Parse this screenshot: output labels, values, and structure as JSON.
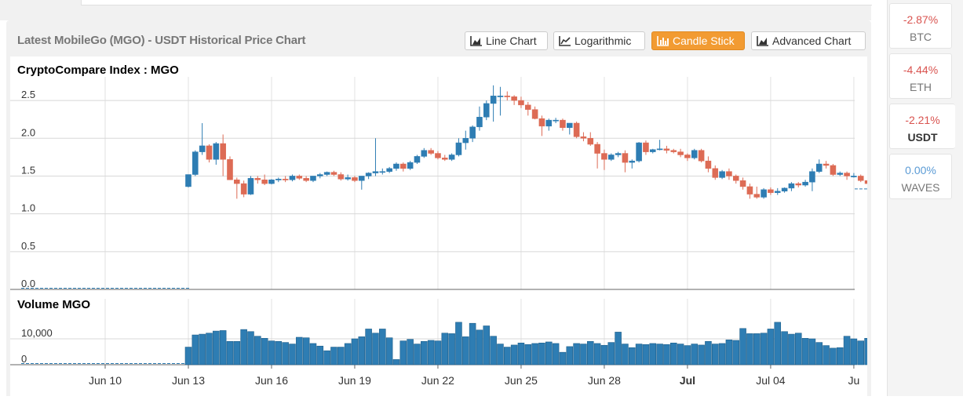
{
  "header": {
    "title": "Latest MobileGo (MGO) - USDT Historical Price Chart",
    "buttons": [
      {
        "label": "Line Chart",
        "icon": "area-chart-icon",
        "active": false
      },
      {
        "label": "Logarithmic",
        "icon": "line-chart-icon",
        "active": false
      },
      {
        "label": "Candle Stick",
        "icon": "bar-chart-icon",
        "active": true
      },
      {
        "label": "Advanced Chart",
        "icon": "area-chart-icon",
        "active": false
      }
    ]
  },
  "sidebar": {
    "pairs": [
      {
        "change": "-2.87%",
        "symbol": "BTC",
        "color": "#d9534f"
      },
      {
        "change": "-4.44%",
        "symbol": "ETH",
        "color": "#d9534f"
      },
      {
        "change": "-2.21%",
        "symbol": "USDT",
        "color": "#d9534f",
        "active": true
      },
      {
        "change": "0.00%",
        "symbol": "WAVES",
        "color": "#5b9bd5"
      }
    ]
  },
  "colors": {
    "up": "#2e7db3",
    "down": "#dd6b55",
    "accent": "#f29b32"
  },
  "chart_data": [
    {
      "type": "candlestick",
      "title": "CryptoCompare Index : MGO",
      "ylim": [
        0,
        2.75
      ],
      "yticks": [
        "0.0",
        "0.5",
        "1.0",
        "1.5",
        "2.0",
        "2.5"
      ],
      "xticks": [
        "Jun 10",
        "Jun 13",
        "Jun 16",
        "Jun 19",
        "Jun 22",
        "Jun 25",
        "Jun 28",
        "Jul",
        "Jul 04",
        "Ju"
      ],
      "bold_xtick": "Jul",
      "candles_per_day": 4,
      "first_candle_date": "Jun 13",
      "last_price": 1.33,
      "ohlc": [
        [
          1.36,
          1.52,
          1.35,
          1.52
        ],
        [
          1.52,
          1.84,
          1.5,
          1.82
        ],
        [
          1.82,
          2.2,
          1.78,
          1.9
        ],
        [
          1.9,
          1.92,
          1.68,
          1.72
        ],
        [
          1.72,
          1.95,
          1.65,
          1.93
        ],
        [
          1.93,
          2.05,
          1.5,
          1.72
        ],
        [
          1.72,
          1.76,
          1.45,
          1.45
        ],
        [
          1.45,
          1.48,
          1.2,
          1.4
        ],
        [
          1.4,
          1.44,
          1.22,
          1.26
        ],
        [
          1.26,
          1.5,
          1.25,
          1.47
        ],
        [
          1.47,
          1.5,
          1.4,
          1.45
        ],
        [
          1.45,
          1.52,
          1.38,
          1.4
        ],
        [
          1.4,
          1.46,
          1.39,
          1.45
        ],
        [
          1.45,
          1.48,
          1.42,
          1.46
        ],
        [
          1.46,
          1.5,
          1.42,
          1.45
        ],
        [
          1.45,
          1.52,
          1.43,
          1.5
        ],
        [
          1.5,
          1.52,
          1.45,
          1.47
        ],
        [
          1.47,
          1.5,
          1.42,
          1.44
        ],
        [
          1.44,
          1.5,
          1.42,
          1.5
        ],
        [
          1.5,
          1.54,
          1.47,
          1.52
        ],
        [
          1.52,
          1.56,
          1.5,
          1.55
        ],
        [
          1.55,
          1.57,
          1.5,
          1.52
        ],
        [
          1.52,
          1.55,
          1.44,
          1.46
        ],
        [
          1.46,
          1.52,
          1.44,
          1.48
        ],
        [
          1.48,
          1.5,
          1.42,
          1.44
        ],
        [
          1.44,
          1.5,
          1.32,
          1.5
        ],
        [
          1.5,
          1.55,
          1.46,
          1.54
        ],
        [
          1.54,
          2.0,
          1.5,
          1.56
        ],
        [
          1.56,
          1.6,
          1.52,
          1.56
        ],
        [
          1.56,
          1.62,
          1.54,
          1.6
        ],
        [
          1.6,
          1.68,
          1.57,
          1.66
        ],
        [
          1.66,
          1.68,
          1.56,
          1.6
        ],
        [
          1.6,
          1.7,
          1.58,
          1.68
        ],
        [
          1.68,
          1.78,
          1.66,
          1.76
        ],
        [
          1.76,
          1.87,
          1.74,
          1.84
        ],
        [
          1.84,
          1.87,
          1.78,
          1.8
        ],
        [
          1.8,
          1.83,
          1.72,
          1.74
        ],
        [
          1.74,
          1.78,
          1.7,
          1.72
        ],
        [
          1.72,
          1.8,
          1.7,
          1.78
        ],
        [
          1.78,
          2.0,
          1.76,
          1.94
        ],
        [
          1.94,
          2.1,
          1.85,
          2.0
        ],
        [
          2.0,
          2.17,
          1.95,
          2.15
        ],
        [
          2.15,
          2.42,
          2.1,
          2.28
        ],
        [
          2.28,
          2.5,
          2.24,
          2.46
        ],
        [
          2.46,
          2.7,
          2.22,
          2.56
        ],
        [
          2.56,
          2.68,
          2.3,
          2.56
        ],
        [
          2.56,
          2.62,
          2.5,
          2.55
        ],
        [
          2.55,
          2.57,
          2.44,
          2.5
        ],
        [
          2.5,
          2.55,
          2.4,
          2.44
        ],
        [
          2.44,
          2.48,
          2.3,
          2.38
        ],
        [
          2.38,
          2.42,
          2.25,
          2.26
        ],
        [
          2.26,
          2.3,
          2.03,
          2.16
        ],
        [
          2.16,
          2.26,
          2.1,
          2.24
        ],
        [
          2.24,
          2.27,
          2.2,
          2.24
        ],
        [
          2.24,
          2.26,
          2.1,
          2.14
        ],
        [
          2.14,
          2.2,
          2.05,
          2.2
        ],
        [
          2.2,
          2.22,
          2.0,
          2.02
        ],
        [
          2.02,
          2.08,
          1.96,
          2.0
        ],
        [
          2.0,
          2.08,
          1.9,
          1.92
        ],
        [
          1.92,
          1.95,
          1.6,
          1.8
        ],
        [
          1.8,
          1.85,
          1.58,
          1.72
        ],
        [
          1.72,
          1.8,
          1.7,
          1.78
        ],
        [
          1.78,
          1.82,
          1.75,
          1.8
        ],
        [
          1.8,
          1.84,
          1.55,
          1.68
        ],
        [
          1.68,
          1.72,
          1.6,
          1.7
        ],
        [
          1.7,
          1.95,
          1.68,
          1.94
        ],
        [
          1.94,
          1.97,
          1.78,
          1.82
        ],
        [
          1.82,
          1.86,
          1.8,
          1.85
        ],
        [
          1.85,
          1.98,
          1.84,
          1.86
        ],
        [
          1.86,
          1.9,
          1.8,
          1.84
        ],
        [
          1.84,
          1.86,
          1.8,
          1.82
        ],
        [
          1.82,
          1.86,
          1.75,
          1.78
        ],
        [
          1.78,
          1.8,
          1.7,
          1.74
        ],
        [
          1.74,
          1.86,
          1.72,
          1.84
        ],
        [
          1.84,
          1.86,
          1.68,
          1.7
        ],
        [
          1.7,
          1.76,
          1.55,
          1.6
        ],
        [
          1.6,
          1.64,
          1.45,
          1.48
        ],
        [
          1.48,
          1.58,
          1.46,
          1.56
        ],
        [
          1.56,
          1.6,
          1.45,
          1.5
        ],
        [
          1.5,
          1.52,
          1.4,
          1.44
        ],
        [
          1.44,
          1.48,
          1.32,
          1.36
        ],
        [
          1.36,
          1.4,
          1.2,
          1.26
        ],
        [
          1.26,
          1.36,
          1.2,
          1.22
        ],
        [
          1.22,
          1.34,
          1.2,
          1.32
        ],
        [
          1.32,
          1.35,
          1.25,
          1.28
        ],
        [
          1.28,
          1.34,
          1.25,
          1.3
        ],
        [
          1.3,
          1.35,
          1.28,
          1.34
        ],
        [
          1.34,
          1.42,
          1.3,
          1.4
        ],
        [
          1.4,
          1.42,
          1.35,
          1.38
        ],
        [
          1.38,
          1.45,
          1.36,
          1.42
        ],
        [
          1.42,
          1.6,
          1.3,
          1.56
        ],
        [
          1.56,
          1.72,
          1.54,
          1.66
        ],
        [
          1.66,
          1.7,
          1.6,
          1.64
        ],
        [
          1.64,
          1.66,
          1.5,
          1.52
        ],
        [
          1.52,
          1.56,
          1.5,
          1.54
        ],
        [
          1.54,
          1.56,
          1.45,
          1.5
        ],
        [
          1.5,
          1.54,
          1.48,
          1.5
        ],
        [
          1.5,
          1.52,
          1.42,
          1.44
        ],
        [
          1.44,
          1.46,
          1.36,
          1.4
        ],
        [
          1.4,
          1.42,
          1.35,
          1.38
        ],
        [
          1.38,
          1.4,
          1.3,
          1.36
        ],
        [
          1.36,
          1.38,
          1.25,
          1.34
        ],
        [
          1.34,
          1.36,
          1.32,
          1.35
        ]
      ]
    },
    {
      "type": "bar",
      "title": "Volume MGO",
      "ylim": [
        0,
        20000
      ],
      "yticks": [
        "0",
        "10,000"
      ],
      "series": [
        {
          "values": [
            6800,
            11500,
            11800,
            12200,
            13000,
            13200,
            9000,
            9000,
            13600,
            12800,
            11000,
            10200,
            9200,
            9000,
            8600,
            8000,
            10600,
            10400,
            8200,
            7200,
            5400,
            6800,
            6800,
            8200,
            10000,
            10800,
            13800,
            12200,
            13800,
            10400,
            2000,
            9200,
            9800,
            8000,
            9000,
            9400,
            9200,
            12200,
            12000,
            16400,
            10800,
            16000,
            13400,
            15000,
            11000,
            8000,
            6800,
            7600,
            8400,
            7800,
            8200,
            8400,
            8800,
            8200,
            4800,
            7000,
            8200,
            8000,
            9000,
            8200,
            7500,
            8600,
            12600,
            8000,
            6600,
            8000,
            7800,
            8200,
            8000,
            7800,
            8400,
            8000,
            7400,
            8000,
            7600,
            9000,
            8000,
            8200,
            9600,
            9400,
            14000,
            12000,
            12000,
            12200,
            13800,
            16400,
            12800,
            11800,
            12200,
            10200,
            10000,
            8600,
            7400,
            6400,
            6600,
            11000,
            10000,
            9200,
            10200,
            9200,
            9600,
            9200,
            8800,
            8800,
            9200,
            9800,
            8400,
            10400,
            9400,
            11800
          ]
        }
      ]
    }
  ]
}
